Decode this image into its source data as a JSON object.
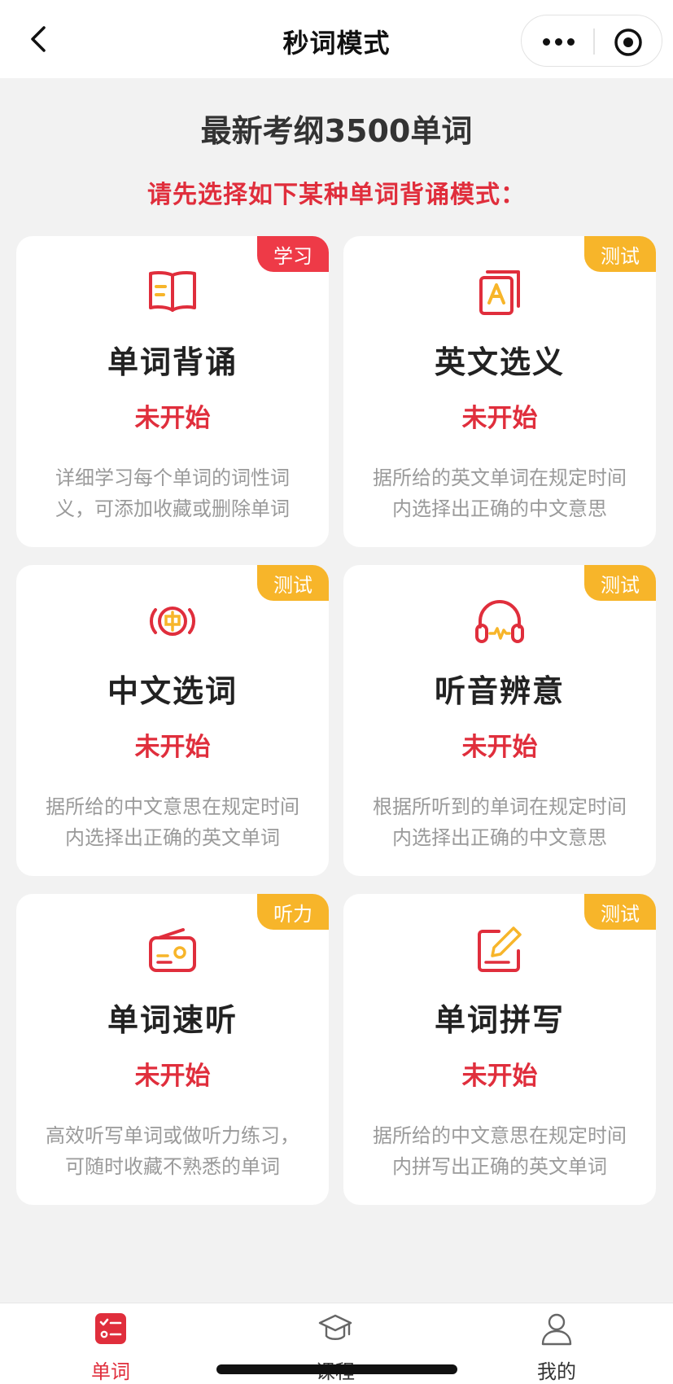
{
  "navbar": {
    "title": "秒词模式"
  },
  "header": {
    "title": "最新考纲3500单词",
    "subtitle": "请先选择如下某种单词背诵模式："
  },
  "cards": [
    {
      "icon": "book-icon",
      "badge": "学习",
      "badge_color": "#ee3a47",
      "title": "单词背诵",
      "status": "未开始",
      "desc": "详细学习每个单词的词性词义，可添加收藏或删除单词"
    },
    {
      "icon": "letter-a-card-icon",
      "badge": "测试",
      "badge_color": "#f7b52a",
      "title": "英文选义",
      "status": "未开始",
      "desc": "据所给的英文单词在规定时间内选择出正确的中文意思"
    },
    {
      "icon": "chinese-char-broadcast-icon",
      "badge": "测试",
      "badge_color": "#f7b52a",
      "title": "中文选词",
      "status": "未开始",
      "desc": "据所给的中文意思在规定时间内选择出正确的英文单词"
    },
    {
      "icon": "headphones-icon",
      "badge": "测试",
      "badge_color": "#f7b52a",
      "title": "听音辨意",
      "status": "未开始",
      "desc": "根据所听到的单词在规定时间内选择出正确的中文意思"
    },
    {
      "icon": "radio-icon",
      "badge": "听力",
      "badge_color": "#f7b52a",
      "title": "单词速听",
      "status": "未开始",
      "desc": "高效听写单词或做听力练习，可随时收藏不熟悉的单词"
    },
    {
      "icon": "edit-pencil-icon",
      "badge": "测试",
      "badge_color": "#f7b52a",
      "title": "单词拼写",
      "status": "未开始",
      "desc": "据所给的中文意思在规定时间内拼写出正确的英文单词"
    }
  ],
  "tabbar": {
    "items": [
      {
        "label": "单词",
        "icon": "word-list-icon",
        "active": true
      },
      {
        "label": "课程",
        "icon": "graduation-cap-icon",
        "active": false
      },
      {
        "label": "我的",
        "icon": "user-icon",
        "active": false
      }
    ]
  },
  "colors": {
    "accent": "#e02e3c",
    "badge_red": "#ee3a47",
    "badge_yellow": "#f7b52a",
    "icon_stroke": "#e02e3c",
    "icon_fill": "#f7b52a"
  }
}
